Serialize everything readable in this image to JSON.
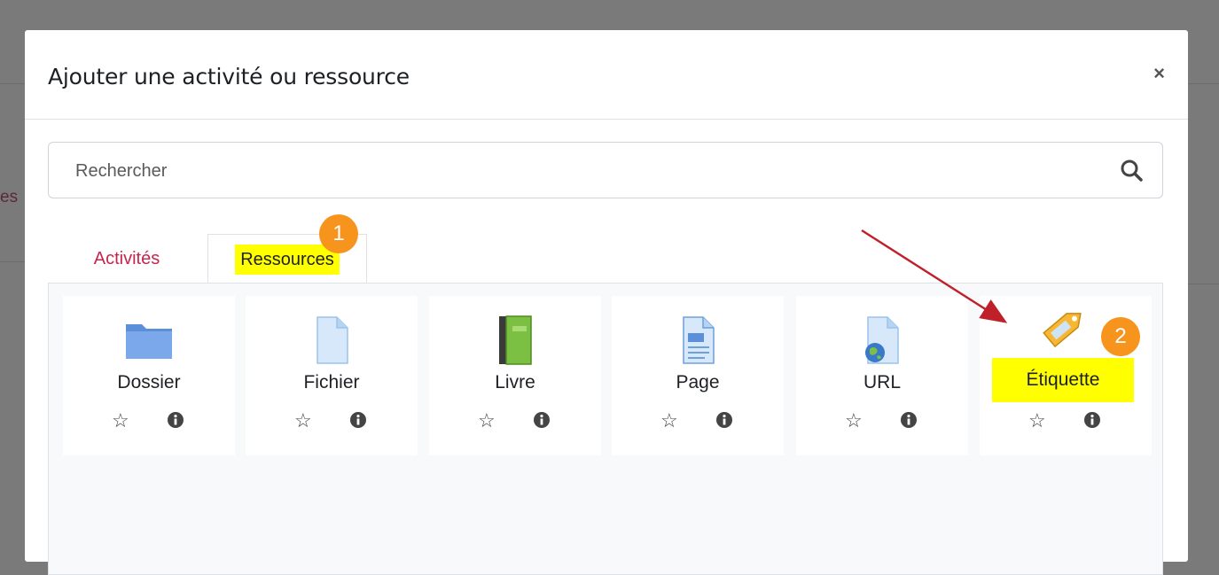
{
  "background": {
    "partial_text": "es"
  },
  "modal": {
    "title": "Ajouter une activité ou ressource",
    "close_label": "×"
  },
  "search": {
    "placeholder": "Rechercher"
  },
  "tabs": [
    {
      "label": "Activités",
      "active": false
    },
    {
      "label": "Ressources",
      "active": true,
      "highlighted": true
    }
  ],
  "annotations": {
    "badge_1": "1",
    "badge_2": "2",
    "badge_color": "#f7941d",
    "highlight_color": "#ffff00",
    "arrow_color": "#c0202a"
  },
  "resources": [
    {
      "label": "Dossier",
      "icon": "folder-icon"
    },
    {
      "label": "Fichier",
      "icon": "file-icon"
    },
    {
      "label": "Livre",
      "icon": "book-icon"
    },
    {
      "label": "Page",
      "icon": "page-icon"
    },
    {
      "label": "URL",
      "icon": "url-icon"
    },
    {
      "label": "Étiquette",
      "icon": "label-tag-icon",
      "highlighted": true
    }
  ],
  "colors": {
    "accent_tab": "#c7254e"
  }
}
